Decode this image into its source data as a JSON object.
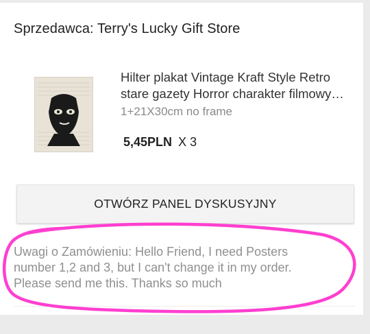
{
  "seller": {
    "label": "Sprzedawca: Terry's Lucky Gift Store"
  },
  "item": {
    "image_icon": "product-poster-image",
    "title_line1": "Hilter plakat Vintage Kraft Style Retro",
    "title_line2": "stare gazety Horror charakter filmowy…",
    "variant": "1+21X30cm no frame",
    "price": "5,45PLN",
    "quantity": "X 3"
  },
  "panel_button": {
    "label": "OTWÓRZ PANEL DYSKUSYJNY"
  },
  "order_note": {
    "line1": "Uwagi o Zamówieniu: Hello Friend, I need Posters",
    "line2": "number 1,2 and 3, but I can't change it in my order.",
    "line3": "Please send me this. Thanks so much"
  },
  "colors": {
    "annotation": "#ff3fd0",
    "background": "#ebebeb"
  }
}
